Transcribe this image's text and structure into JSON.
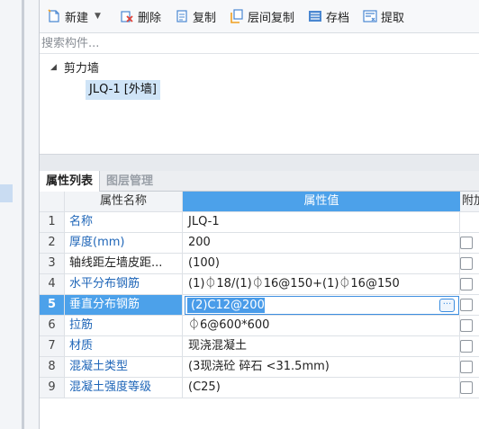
{
  "toolbar": {
    "new_label": "新建",
    "delete_label": "删除",
    "copy_label": "复制",
    "floor_copy_label": "层间复制",
    "archive_label": "存档",
    "extract_label": "提取"
  },
  "search": {
    "placeholder": "搜索构件..."
  },
  "tree": {
    "group": "剪力墙",
    "items": [
      "JLQ-1 [外墙]"
    ]
  },
  "tabs": [
    "属性列表",
    "图层管理"
  ],
  "grid": {
    "headers": {
      "name": "属性名称",
      "value": "属性值",
      "extra": "附加"
    },
    "rows": [
      {
        "idx": "1",
        "name": "名称",
        "value": "JLQ-1"
      },
      {
        "idx": "2",
        "name": "厚度(mm)",
        "value": "200"
      },
      {
        "idx": "3",
        "name": "轴线距左墙皮距...",
        "value": "(100)"
      },
      {
        "idx": "4",
        "name": "水平分布钢筋",
        "value": "(1)⏀18/(1)⏀16@150+(1)⏀16@150"
      },
      {
        "idx": "5",
        "name": "垂直分布钢筋",
        "value": "(2)C12@200"
      },
      {
        "idx": "6",
        "name": "拉筋",
        "value": "⏀6@600*600"
      },
      {
        "idx": "7",
        "name": "材质",
        "value": "现浇混凝土"
      },
      {
        "idx": "8",
        "name": "混凝土类型",
        "value": "(3现浇砼 碎石 <31.5mm)"
      },
      {
        "idx": "9",
        "name": "混凝土强度等级",
        "value": "(C25)"
      }
    ]
  },
  "colors": {
    "accent": "#4ca1ea",
    "link": "#1f66b8"
  }
}
